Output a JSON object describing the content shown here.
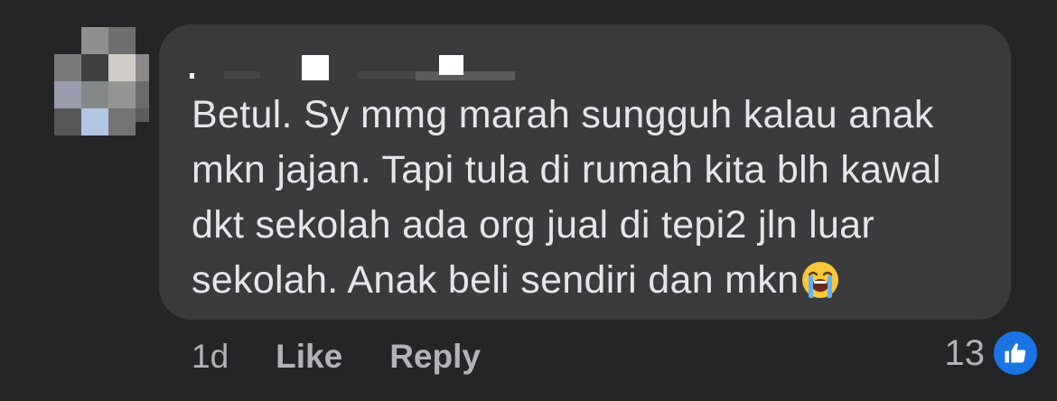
{
  "comment": {
    "text": "Betul. Sy mmg marah sungguh kalau anak mkn jajan. Tapi tula di rumah kita blh kawal dkt sekolah ada org jual di tepi2 jln luar sekolah. Anak beli sendiri dan mkn",
    "lines": [
      "Betul. Sy mmg marah sungguh kalau anak",
      "mkn jajan. Tapi tula di rumah kita blh kawal",
      "dkt sekolah ada org jual di tepi2 jln luar",
      "sekolah. Anak beli sendiri dan mkn"
    ],
    "emoji": "loudly-crying-face"
  },
  "actions": {
    "time": "1d",
    "like_label": "Like",
    "reply_label": "Reply"
  },
  "reactions": {
    "count": "13",
    "icon": "thumbs-up-icon",
    "badge_color": "#1b74e4"
  },
  "colors": {
    "background": "#242526",
    "bubble": "#3a3b3c",
    "text": "#e4e6eb",
    "secondary_text": "#b0b3b8"
  }
}
